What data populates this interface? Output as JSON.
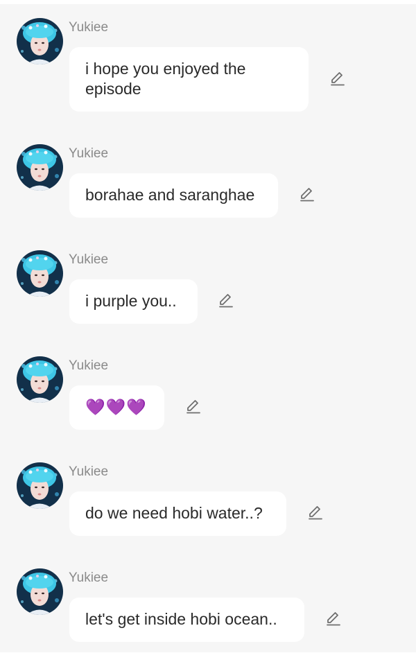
{
  "messages": [
    {
      "sender": "Yukiee",
      "text": "i hope you enjoyed the\nepisode",
      "edit_icon": "pencil-icon"
    },
    {
      "sender": "Yukiee",
      "text": "borahae and saranghae",
      "edit_icon": "pencil-icon"
    },
    {
      "sender": "Yukiee",
      "text": "i purple you..",
      "edit_icon": "pencil-icon"
    },
    {
      "sender": "Yukiee",
      "text": "💜💜💜",
      "edit_icon": "pencil-icon"
    },
    {
      "sender": "Yukiee",
      "text": "do we need hobi water..?",
      "edit_icon": "pencil-icon"
    },
    {
      "sender": "Yukiee",
      "text": "let's get inside hobi ocean..",
      "edit_icon": "pencil-icon"
    }
  ],
  "colors": {
    "background": "#f6f6f6",
    "bubble": "#ffffff",
    "sender_text": "#8a8a8a",
    "message_text": "#2a2a2a",
    "edit_icon": "#6e6e6e",
    "heart": "#9b3fd0"
  }
}
